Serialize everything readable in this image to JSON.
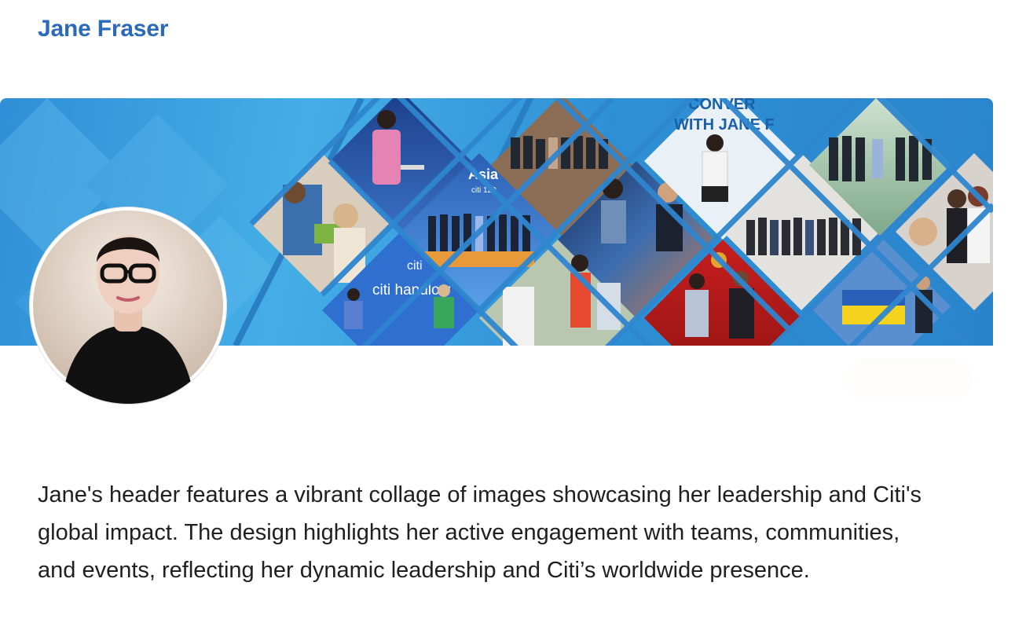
{
  "profile": {
    "name": "Jane Fraser"
  },
  "banner": {
    "photo_texts": {
      "conversation_line1": "CONVER",
      "conversation_line2": "WITH JANE F",
      "asia_event": "Asia",
      "asia_event_sub": "citi 120",
      "citi_logo": "citi",
      "citi_handlow": "citi handlow"
    },
    "colors": {
      "background": "#3a9fe0",
      "diamond_frame": "#2a7fc4"
    }
  },
  "avatar": {
    "description_icon": "portrait-photo"
  },
  "description": {
    "text": "Jane's header features a vibrant collage of images showcasing her leadership and Citi's global impact. The design highlights her active engagement with teams, communities, and events, reflecting her dynamic leadership and Citi’s worldwide presence."
  }
}
